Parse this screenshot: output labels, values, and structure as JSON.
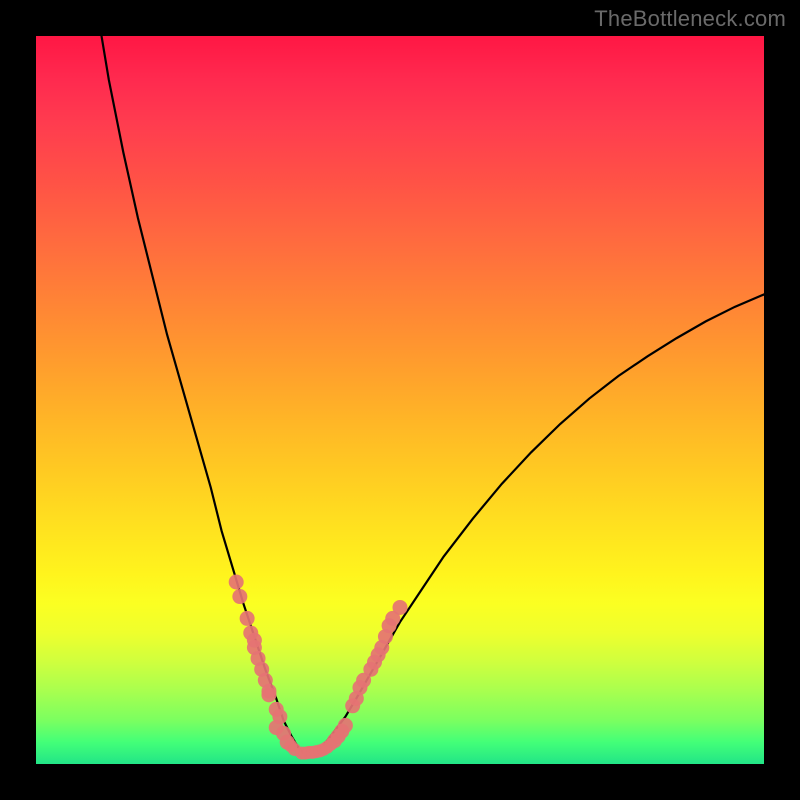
{
  "watermark": "TheBottleneck.com",
  "colors": {
    "background": "#000000",
    "curve": "#000000",
    "markers": "#e57373"
  },
  "chart_data": {
    "type": "line",
    "title": "",
    "xlabel": "",
    "ylabel": "",
    "xlim": [
      0,
      100
    ],
    "ylim": [
      0,
      100
    ],
    "grid": false,
    "legend": false,
    "series": [
      {
        "name": "bottleneck-curve-left",
        "x": [
          9,
          10,
          12,
          14,
          16,
          18,
          20,
          22,
          24,
          25.5,
          27,
          28.5,
          30,
          31.5,
          33,
          34,
          35,
          36,
          37
        ],
        "y": [
          100,
          94,
          84,
          75,
          67,
          59,
          52,
          45,
          38,
          32,
          27,
          22,
          17.5,
          13,
          9,
          6,
          4,
          2.3,
          1.2
        ]
      },
      {
        "name": "bottleneck-curve-right",
        "x": [
          37,
          38,
          39,
          40,
          41,
          42.5,
          44,
          46,
          48,
          50,
          53,
          56,
          60,
          64,
          68,
          72,
          76,
          80,
          84,
          88,
          92,
          96,
          100
        ],
        "y": [
          1.2,
          1.5,
          2.2,
          3.2,
          4.5,
          6.5,
          9,
          12.5,
          16,
          19.5,
          24,
          28.5,
          33.7,
          38.5,
          42.8,
          46.7,
          50.2,
          53.3,
          56,
          58.5,
          60.8,
          62.8,
          64.5
        ]
      },
      {
        "name": "markers-left-cluster",
        "x": [
          27.5,
          28,
          29,
          29.5,
          30,
          30,
          30.5,
          31,
          31.5,
          32,
          32,
          33,
          33.5
        ],
        "y": [
          25,
          23,
          20,
          18,
          17,
          16,
          14.5,
          13,
          11.5,
          10,
          9.5,
          7.5,
          6.5
        ]
      },
      {
        "name": "markers-bottom-cluster",
        "x": [
          33,
          34,
          34.5,
          35,
          35.5,
          36.5,
          37,
          37.5,
          38,
          38.5,
          39,
          39.5,
          40,
          40.5,
          41,
          41.5,
          42,
          42.5
        ],
        "y": [
          5,
          4.2,
          3,
          2.5,
          2,
          1.5,
          1.5,
          1.6,
          1.6,
          1.7,
          1.8,
          2,
          2.3,
          2.7,
          3.2,
          3.8,
          4.5,
          5.3
        ]
      },
      {
        "name": "markers-right-cluster",
        "x": [
          43.5,
          44,
          44.5,
          45,
          46,
          46.5,
          47,
          47.5,
          48,
          48.5,
          49,
          50
        ],
        "y": [
          8,
          9,
          10.5,
          11.5,
          13,
          14,
          15,
          16,
          17.5,
          19,
          20,
          21.5
        ]
      }
    ]
  }
}
